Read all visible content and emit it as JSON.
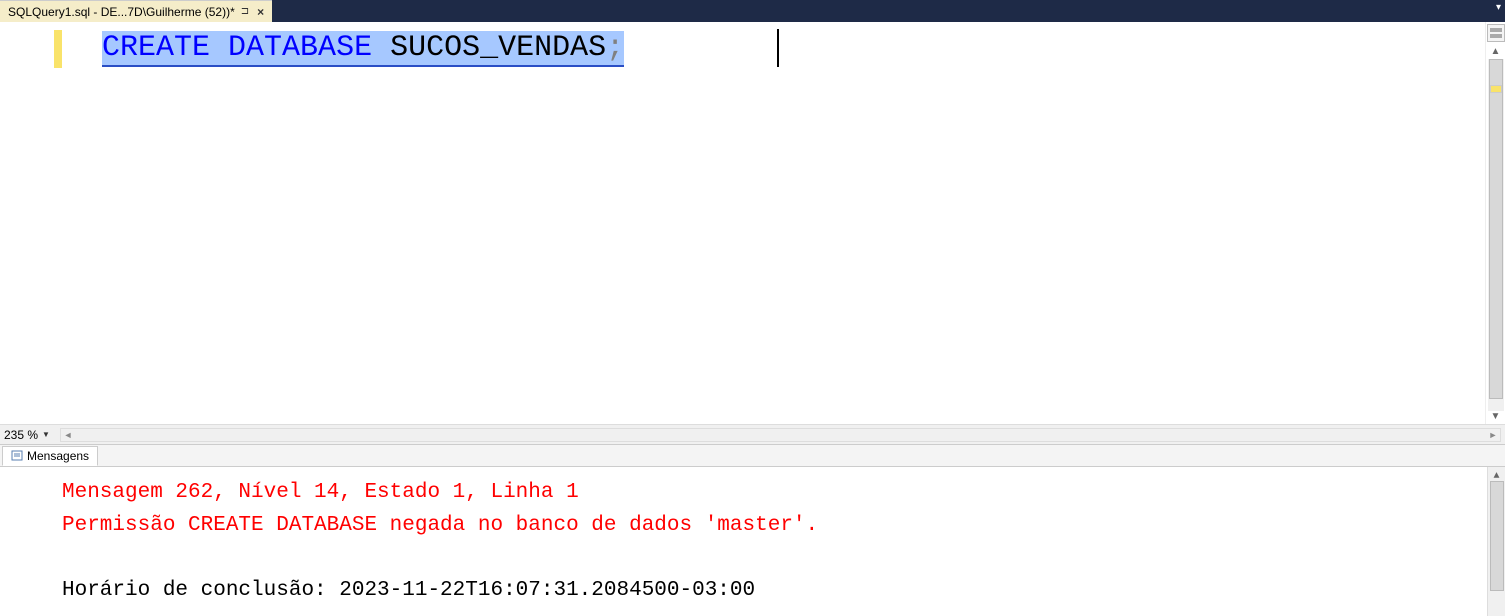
{
  "tab": {
    "title": "SQLQuery1.sql - DE...7D\\Guilherme (52))*"
  },
  "editor": {
    "code_keyword1": "CREATE",
    "code_keyword2": "DATABASE",
    "code_identifier": "SUCOS_VENDAS",
    "code_semicolon": ";",
    "zoom_level": "235 %"
  },
  "results": {
    "tab_label": "Mensagens",
    "error_line1": "Mensagem 262, Nível 14, Estado 1, Linha 1",
    "error_line2": "Permissão CREATE DATABASE negada no banco de dados 'master'.",
    "completion_line": "Horário de conclusão: 2023-11-22T16:07:31.2084500-03:00"
  }
}
